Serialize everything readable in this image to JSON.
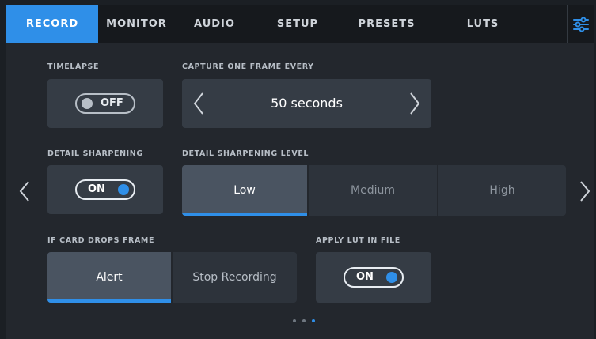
{
  "tabs": [
    {
      "label": "RECORD",
      "active": true
    },
    {
      "label": "MONITOR",
      "active": false
    },
    {
      "label": "AUDIO",
      "active": false
    },
    {
      "label": "SETUP",
      "active": false
    },
    {
      "label": "PRESETS",
      "active": false
    },
    {
      "label": "LUTS",
      "active": false
    }
  ],
  "menu_icon": "sliders-icon",
  "timelapse": {
    "label": "TIMELAPSE",
    "toggle": "OFF"
  },
  "capture": {
    "label": "CAPTURE ONE FRAME EVERY",
    "value": "50 seconds"
  },
  "detail_sharpening": {
    "label": "DETAIL SHARPENING",
    "toggle": "ON"
  },
  "sharpening_level": {
    "label": "DETAIL SHARPENING LEVEL",
    "options": [
      "Low",
      "Medium",
      "High"
    ],
    "selected": "Low"
  },
  "card_drops": {
    "label": "IF CARD DROPS FRAME",
    "options": [
      "Alert",
      "Stop Recording"
    ],
    "selected": "Alert"
  },
  "apply_lut": {
    "label": "APPLY LUT IN FILE",
    "toggle": "ON"
  },
  "pagination": {
    "pages": 3,
    "current": 3
  },
  "colors": {
    "accent": "#2f8fe8",
    "panel": "#353c45",
    "background": "#23272d",
    "tabbar": "#16191d"
  }
}
